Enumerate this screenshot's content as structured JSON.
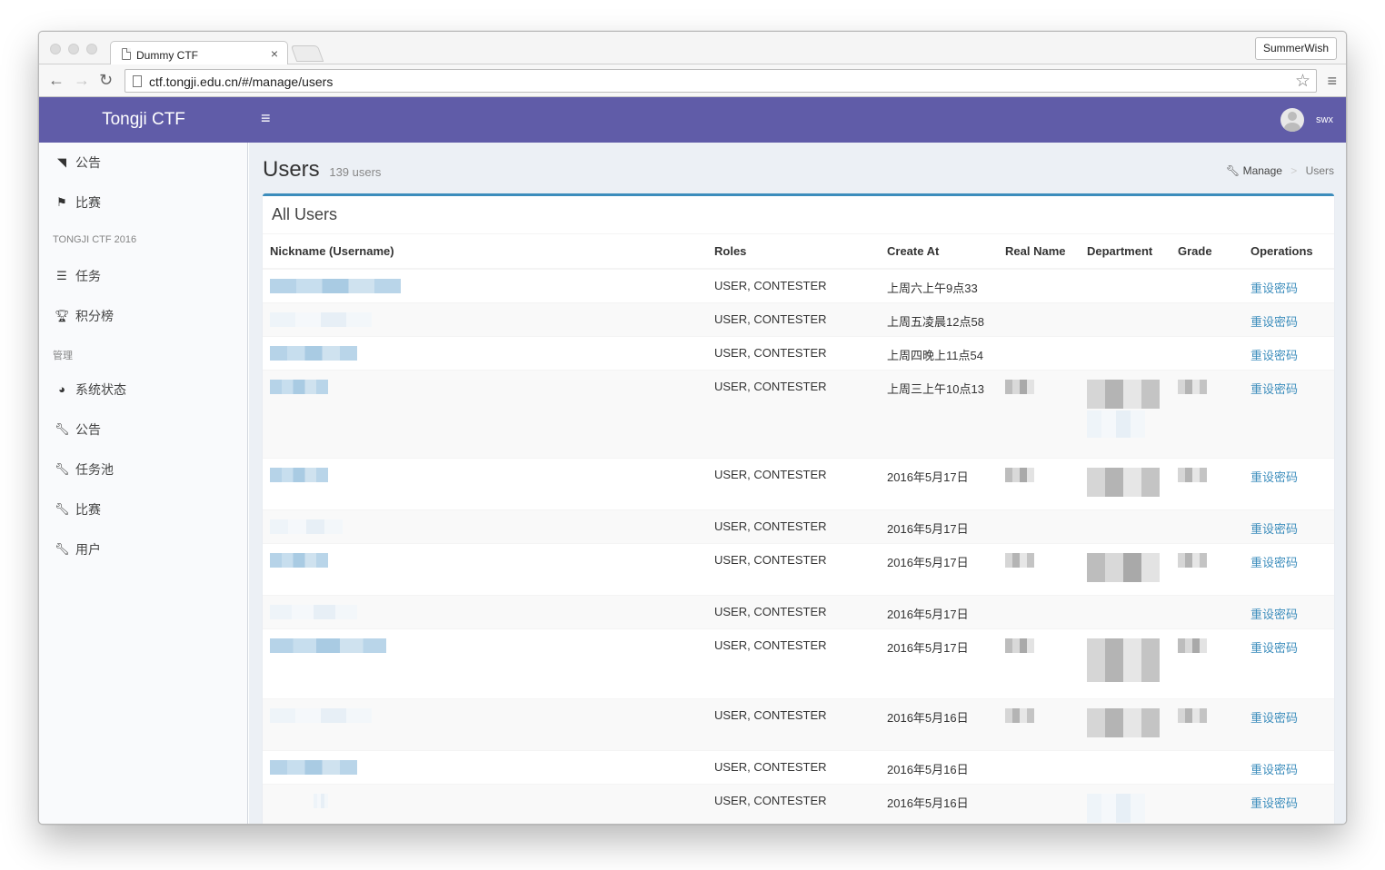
{
  "browser": {
    "tab_title": "Dummy CTF",
    "tab_close": "×",
    "profile_name": "SummerWish",
    "url": "ctf.tongji.edu.cn/#/manage/users"
  },
  "header": {
    "brand": "Tongji CTF",
    "username": "swx"
  },
  "sidebar": {
    "items_top": [
      {
        "icon": "rss-icon",
        "label": "公告"
      },
      {
        "icon": "flag-icon",
        "label": "比赛"
      }
    ],
    "section_contest": "TONGJI CTF 2016",
    "items_contest": [
      {
        "icon": "list-icon",
        "label": "任务"
      },
      {
        "icon": "trophy-icon",
        "label": "积分榜"
      }
    ],
    "section_manage": "管理",
    "items_manage": [
      {
        "icon": "dashboard-icon",
        "label": "系统状态"
      },
      {
        "icon": "wrench-icon",
        "label": "公告"
      },
      {
        "icon": "wrench-icon",
        "label": "任务池"
      },
      {
        "icon": "wrench-icon",
        "label": "比赛"
      },
      {
        "icon": "wrench-icon",
        "label": "用户"
      }
    ]
  },
  "page": {
    "title": "Users",
    "subtitle": "139 users",
    "breadcrumb": [
      "Manage",
      "Users"
    ]
  },
  "table": {
    "box_title": "All Users",
    "columns": [
      "Nickname (Username)",
      "Roles",
      "Create At",
      "Real Name",
      "Department",
      "Grade",
      "Operations"
    ],
    "rows": [
      {
        "roles": "USER, CONTESTER",
        "created": "上周六上午9点33",
        "op": "重设密码"
      },
      {
        "roles": "USER, CONTESTER",
        "created": "上周五凌晨12点58",
        "op": "重设密码"
      },
      {
        "roles": "USER, CONTESTER",
        "created": "上周四晚上11点54",
        "op": "重设密码"
      },
      {
        "roles": "USER, CONTESTER",
        "created": "上周三上午10点13",
        "op": "重设密码"
      },
      {
        "roles": "USER, CONTESTER",
        "created": "2016年5月17日",
        "op": "重设密码"
      },
      {
        "roles": "USER, CONTESTER",
        "created": "2016年5月17日",
        "op": "重设密码"
      },
      {
        "roles": "USER, CONTESTER",
        "created": "2016年5月17日",
        "op": "重设密码"
      },
      {
        "roles": "USER, CONTESTER",
        "created": "2016年5月17日",
        "op": "重设密码"
      },
      {
        "roles": "USER, CONTESTER",
        "created": "2016年5月17日",
        "op": "重设密码"
      },
      {
        "roles": "USER, CONTESTER",
        "created": "2016年5月16日",
        "op": "重设密码"
      },
      {
        "roles": "USER, CONTESTER",
        "created": "2016年5月16日",
        "op": "重设密码"
      },
      {
        "roles": "USER, CONTESTER",
        "created": "2016年5月16日",
        "op": "重设密码"
      }
    ]
  },
  "colors": {
    "header_bg": "#605ca8",
    "box_accent": "#3c8dbc",
    "link": "#3c8dbc",
    "sidebar_bg": "#f9fafc",
    "content_bg": "#ecf0f5"
  }
}
